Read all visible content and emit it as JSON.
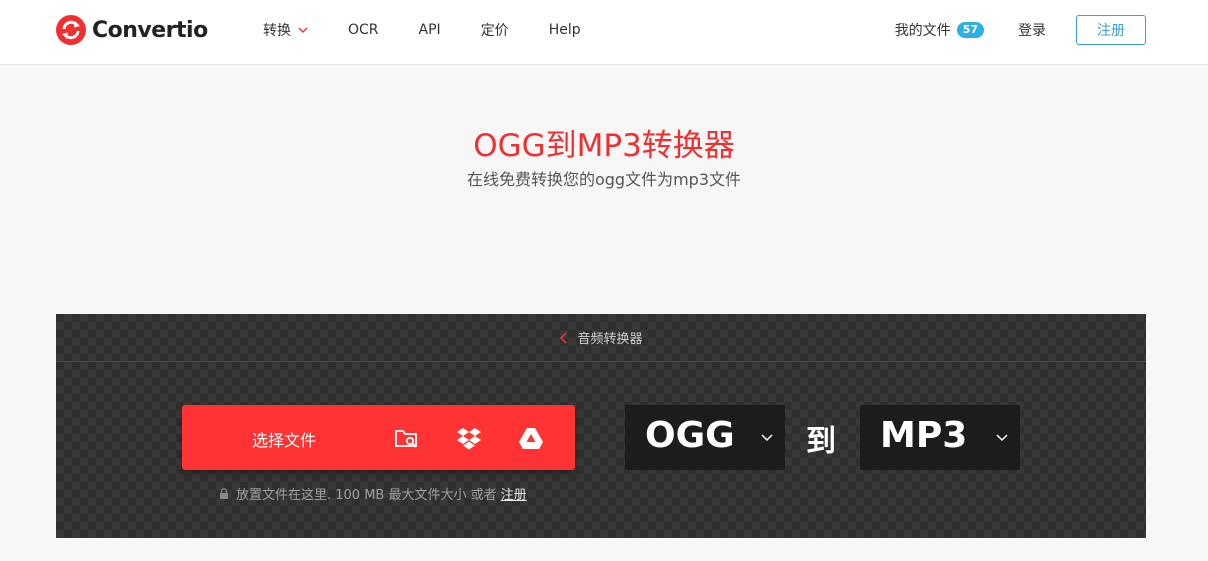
{
  "header": {
    "brand": "Convertio",
    "nav": [
      {
        "label": "转换",
        "has_dropdown": true
      },
      {
        "label": "OCR"
      },
      {
        "label": "API"
      },
      {
        "label": "定价"
      },
      {
        "label": "Help"
      }
    ],
    "my_files_label": "我的文件",
    "my_files_count": "57",
    "login_label": "登录",
    "signup_label": "注册"
  },
  "hero": {
    "title": "OGG到MP3转换器",
    "subtitle": "在线免费转换您的ogg文件为mp3文件"
  },
  "converter": {
    "back_label": "音频转换器",
    "choose_label": "选择文件",
    "hint_text": "放置文件在这里. 100 MB 最大文件大小 或者",
    "hint_link": "注册",
    "from_format": "OGG",
    "to_word": "到",
    "to_format": "MP3"
  },
  "colors": {
    "accent": "#ff3333",
    "title_red": "#f03030",
    "signup_blue": "#3a9fd8",
    "badge_blue": "#2bb1e3"
  },
  "icons": [
    "logo-icon",
    "chevron-down-icon",
    "chevron-left-icon",
    "folder-search-icon",
    "dropbox-icon",
    "google-drive-icon",
    "lock-icon"
  ]
}
